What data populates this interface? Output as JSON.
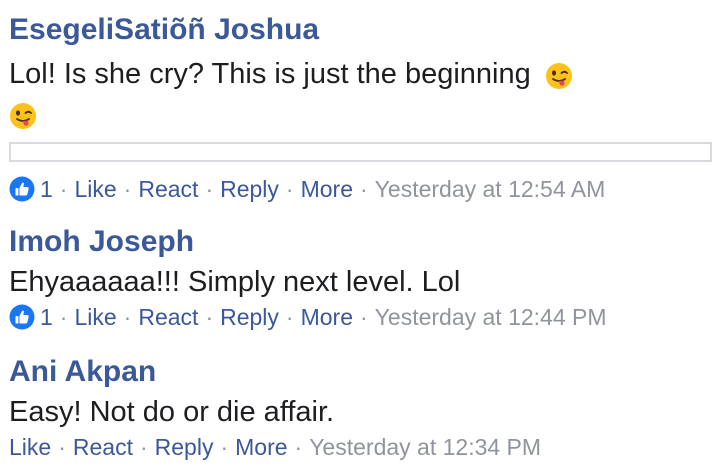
{
  "comments": [
    {
      "author": "EsegeliSatiõñ Joshua",
      "text": "Lol! Is she cry? This is just the beginning",
      "emoji": "winking-tongue-emoji",
      "likes": "1",
      "actions": [
        "Like",
        "React",
        "Reply",
        "More"
      ],
      "time": "Yesterday at 12:54 AM"
    },
    {
      "author": "Imoh Joseph",
      "text": "Ehyaaaaaa!!! Simply next level. Lol",
      "likes": "1",
      "actions": [
        "Like",
        "React",
        "Reply",
        "More"
      ],
      "time": "Yesterday at 12:44 PM"
    },
    {
      "author": "Ani Akpan",
      "text": "Easy! Not do or die affair.",
      "actions": [
        "Like",
        "React",
        "Reply",
        "More"
      ],
      "time": "Yesterday at 12:34 PM"
    }
  ],
  "separator": "·",
  "colors": {
    "author": "#3b5998",
    "link": "#3b5998",
    "meta": "#90949c",
    "like_badge": "#1877f2"
  }
}
